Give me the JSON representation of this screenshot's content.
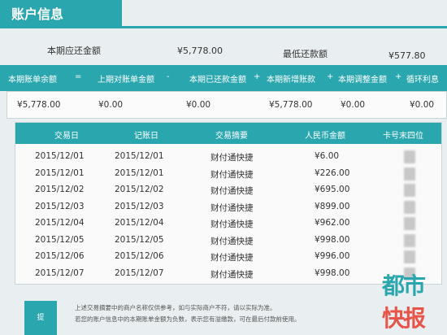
{
  "header": {
    "title": "账户信息"
  },
  "summary": {
    "due_label": "本期应还金额",
    "due_value": "¥5,778.00",
    "min_label": "最低还款额",
    "min_value": "¥577.80"
  },
  "formula": {
    "labels": [
      "本期账单余额",
      "=",
      "上期对账单金额",
      "-",
      "本期已还款金额",
      "+",
      "本期新增账款",
      "+",
      "本期调整金额",
      "+",
      "循环利息"
    ],
    "values": [
      "¥5,778.00",
      "¥0.00",
      "¥0.00",
      "¥5,778.00",
      "¥0.00",
      "¥0.00"
    ]
  },
  "transactions": {
    "headers": [
      "交易日",
      "记账日",
      "交易摘要",
      "人民币金额",
      "卡号末四位"
    ],
    "rows": [
      {
        "trade_date": "2015/12/01",
        "post_date": "2015/12/01",
        "desc": "财付通快捷",
        "amount": "¥6.00"
      },
      {
        "trade_date": "2015/12/01",
        "post_date": "2015/12/01",
        "desc": "财付通快捷",
        "amount": "¥226.00"
      },
      {
        "trade_date": "2015/12/02",
        "post_date": "2015/12/02",
        "desc": "财付通快捷",
        "amount": "¥695.00"
      },
      {
        "trade_date": "2015/12/03",
        "post_date": "2015/12/03",
        "desc": "财付通快捷",
        "amount": "¥899.00"
      },
      {
        "trade_date": "2015/12/04",
        "post_date": "2015/12/04",
        "desc": "财付通快捷",
        "amount": "¥962.00"
      },
      {
        "trade_date": "2015/12/05",
        "post_date": "2015/12/05",
        "desc": "财付通快捷",
        "amount": "¥998.00"
      },
      {
        "trade_date": "2015/12/06",
        "post_date": "2015/12/06",
        "desc": "财付通快捷",
        "amount": "¥996.00"
      },
      {
        "trade_date": "2015/12/07",
        "post_date": "2015/12/07",
        "desc": "财付通快捷",
        "amount": "¥998.00"
      }
    ]
  },
  "footer": {
    "button_label": "提",
    "note_line1": "上述交易摘要中的商户名称仅供参考，如与实际商户不符，请以实际为准。",
    "note_line2": "若您的账户信息中的本期账单金额为负数，表示您有溢缴款，可在最后付款前使用。"
  },
  "watermark": {
    "line1": "都市",
    "line2": "快报"
  },
  "colors": {
    "teal": "#2aa6ae",
    "watermark_red": "#e7554a"
  }
}
